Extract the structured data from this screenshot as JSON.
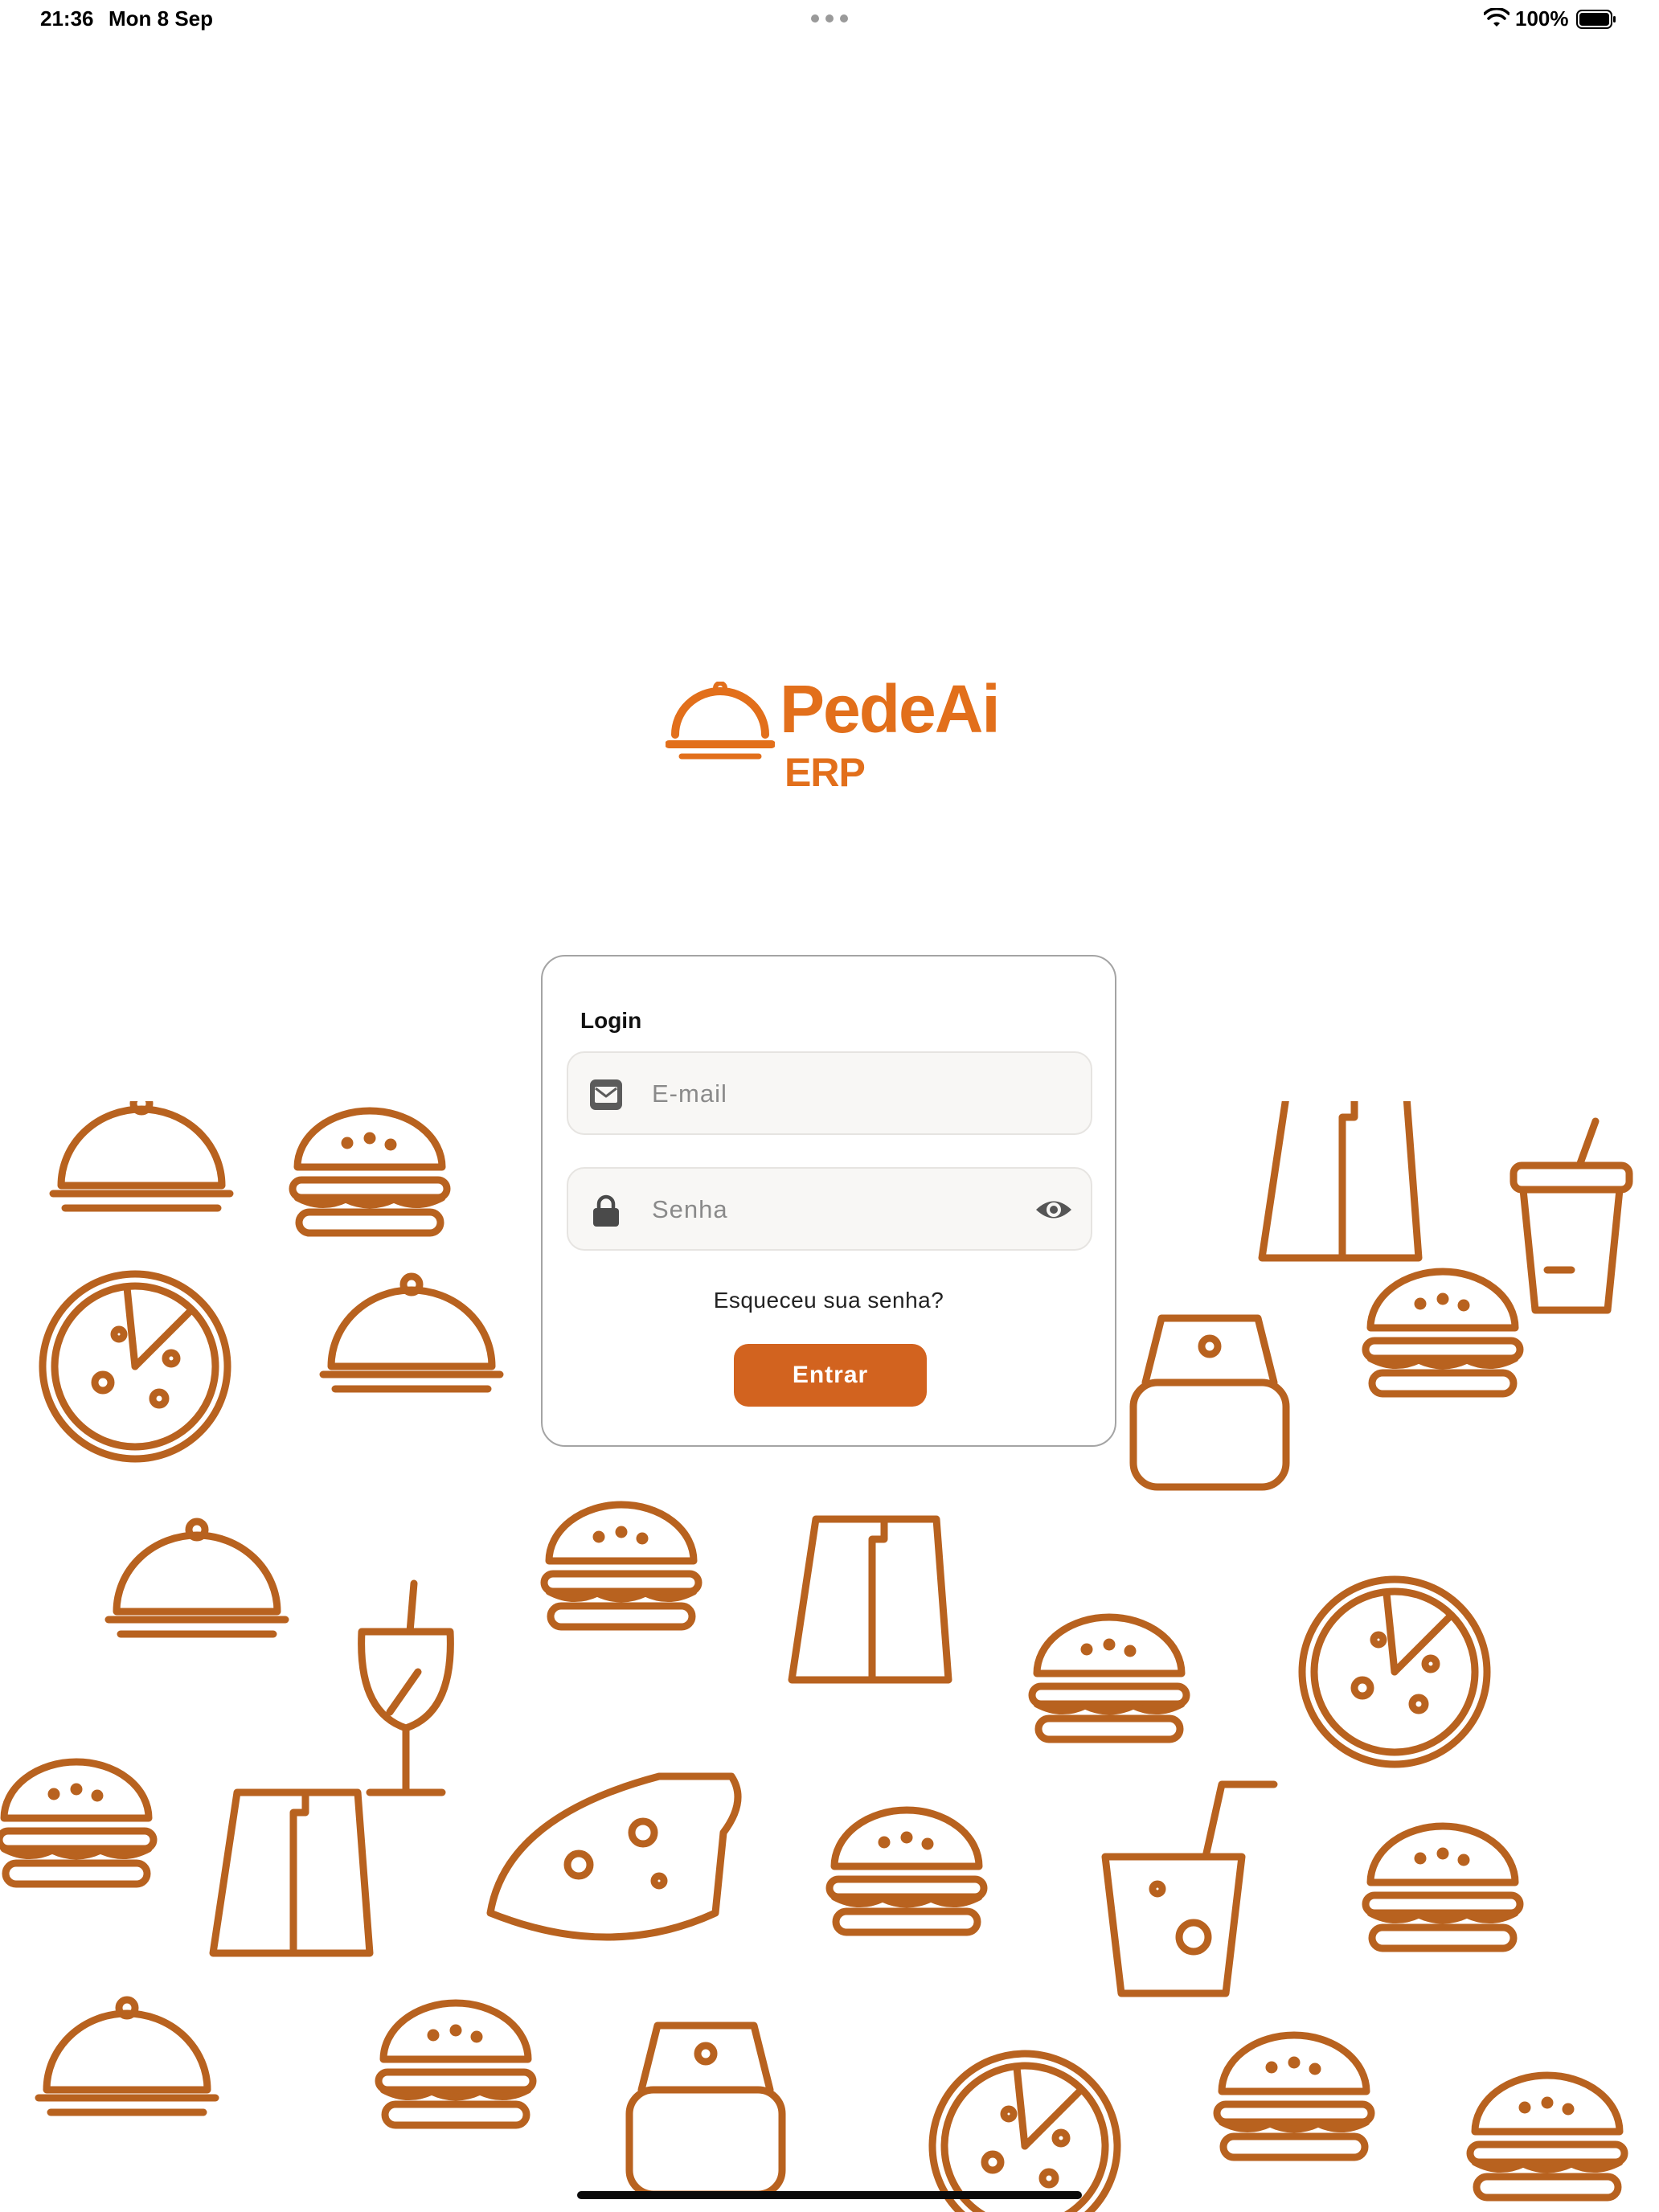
{
  "status_bar": {
    "time": "21:36",
    "date": "Mon 8 Sep",
    "battery_percent": "100%",
    "icons": [
      "wifi-icon",
      "battery-icon",
      "multitasking-dots-icon"
    ]
  },
  "brand": {
    "name": "PedeAi",
    "subtitle": "ERP",
    "logo_icon": "cloche-icon",
    "accent_color": "#e26f1b"
  },
  "login": {
    "title": "Login",
    "email": {
      "value": "",
      "placeholder": "E-mail",
      "icon": "envelope-icon"
    },
    "password": {
      "value": "",
      "placeholder": "Senha",
      "icon": "lock-icon",
      "toggle_icon": "eye-icon"
    },
    "forgot_password": "Esqueceu sua senha?",
    "submit": "Entrar",
    "button_color": "#d2631f"
  },
  "background": {
    "pattern_icons": [
      "burger-icon",
      "pizza-icon",
      "cloche-icon",
      "cup-icon",
      "drink-icon",
      "bag-icon",
      "wine-glass-icon"
    ],
    "pattern_color": "#b8621f"
  }
}
